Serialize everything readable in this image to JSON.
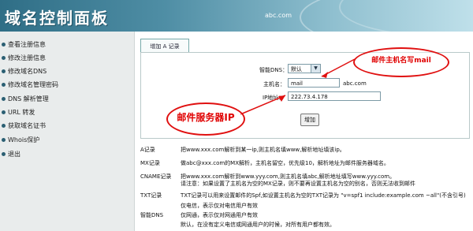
{
  "header": {
    "title": "域名控制面板",
    "domain": "abc.com"
  },
  "sidebar": {
    "items": [
      {
        "label": "查看注册信息"
      },
      {
        "label": "修改注册信息"
      },
      {
        "label": "修改域名DNS"
      },
      {
        "label": "修改域名管理密码"
      },
      {
        "label": "DNS 解析管理"
      },
      {
        "label": "URL 转发"
      },
      {
        "label": "获取域名证书"
      },
      {
        "label": "Whois保护"
      },
      {
        "label": "退出"
      }
    ]
  },
  "tab": {
    "label": "增加 A 记录"
  },
  "form": {
    "smart_dns_label": "智能DNS：",
    "smart_dns_value": "默认",
    "host_label": "主机名：",
    "host_value": "mail",
    "host_suffix": "abc.com",
    "ip_label": "IP地址：",
    "ip_value": "222.73.4.178",
    "add_button": "增加"
  },
  "annotations": {
    "mail_host": "邮件主机名写mail",
    "mail_ip": "邮件服务器IP"
  },
  "records": [
    {
      "key": "A记录",
      "desc": "把www.xxx.com解析到某一ip,则主机名填www,解析地址填该ip。"
    },
    {
      "key": "MX记录",
      "desc": "做abc@xxx.com的MX解析，主机名留空，优先级10，解析地址为邮件服务器域名。"
    },
    {
      "key": "CNAME记录",
      "desc": "把www.xxx.com解析到www.yyy.com,则主机名填abc,解析地址填写www.yyy.com。"
    },
    {
      "key": "",
      "desc": "请注意：如果设置了主机名为空的MX记录，则不要再设置主机名为空的别名，否则无法收到邮件"
    },
    {
      "key": "TXT记录",
      "desc": "TXT记录可以用来设置邮件的Spf,如设置主机名为空的TXT记录为 \"v=spf1 include:example.com ~all\"(不含引号)"
    },
    {
      "key": "",
      "desc": "仅电信，表示仅对电信用户有效"
    },
    {
      "key": "智能DNS",
      "desc": "仅网通，表示仅对网通用户有效"
    },
    {
      "key": "",
      "desc": "默认，在没有定义电信或网通用户的时候，对所有用户都有效。"
    }
  ]
}
